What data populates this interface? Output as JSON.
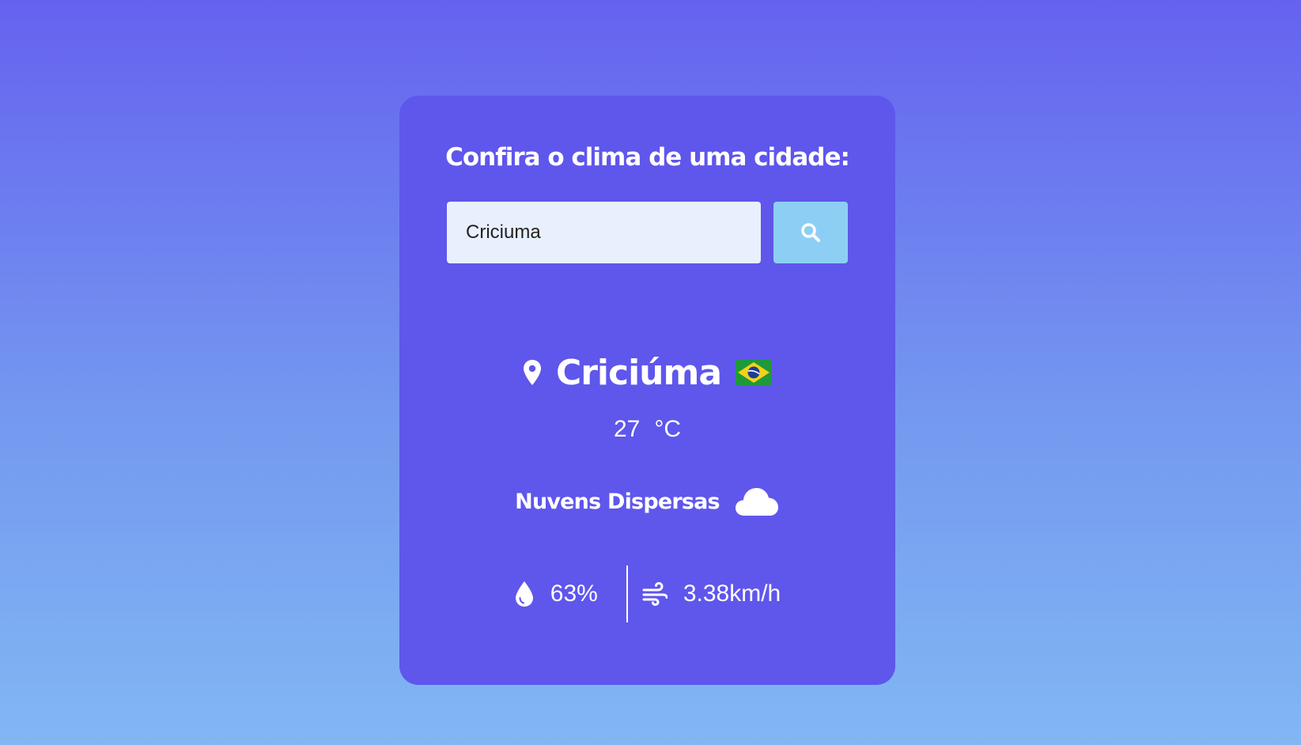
{
  "search": {
    "title": "Confira o clima de uma cidade:",
    "input_value": "Criciuma"
  },
  "weather": {
    "city": "Criciúma",
    "country_flag": "brazil-flag-icon",
    "temperature": "27",
    "unit": "°C",
    "description": "Nuvens Dispersas",
    "condition_icon": "cloud-icon",
    "humidity": "63%",
    "wind": "3.38km/h"
  },
  "colors": {
    "card_background": "#5f56ec",
    "search_button": "#8dcff4",
    "input_background": "#e8effd",
    "gradient_top": "#6562ef",
    "gradient_bottom": "#81b7f3"
  }
}
